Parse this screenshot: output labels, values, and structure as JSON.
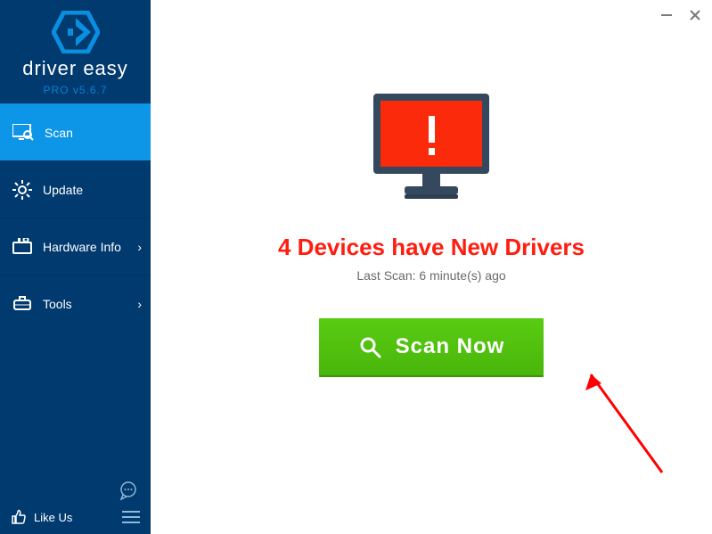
{
  "branding": {
    "name": "driver easy",
    "version": "PRO v5.6.7"
  },
  "sidebar": {
    "items": [
      {
        "label": "Scan",
        "icon": "monitor-search-icon",
        "expandable": false
      },
      {
        "label": "Update",
        "icon": "gear-icon",
        "expandable": false
      },
      {
        "label": "Hardware Info",
        "icon": "hardware-icon",
        "expandable": true
      },
      {
        "label": "Tools",
        "icon": "tools-icon",
        "expandable": true
      }
    ],
    "footer": {
      "like_label": "Like Us"
    }
  },
  "main": {
    "status_text": "4 Devices have New Drivers",
    "last_scan_text": "Last Scan: 6 minute(s) ago",
    "scan_button": "Scan Now"
  },
  "colors": {
    "sidebar_bg": "#003a6f",
    "active_bg": "#0d96e8",
    "accent": "#0a7fd6",
    "status_red": "#ff1d0f",
    "scan_green": "#49b60b",
    "monitor_red": "#fa2a0a",
    "monitor_frame": "#34495e"
  }
}
